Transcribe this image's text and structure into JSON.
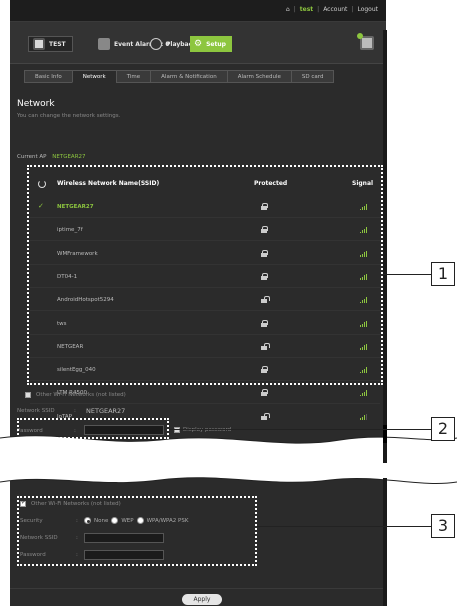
{
  "topbar": {
    "home_icon": "home-icon",
    "user": "test",
    "account": "Account",
    "logout": "Logout",
    "sep": "|"
  },
  "toolbar": {
    "test_label": "TEST",
    "event_alarms_label": "Event Alarms : 0",
    "playback_label": "Playback",
    "setup_label": "Setup"
  },
  "tabs": [
    {
      "label": "Basic Info"
    },
    {
      "label": "Network"
    },
    {
      "label": "Time"
    },
    {
      "label": "Alarm & Notification"
    },
    {
      "label": "Alarm Schedule"
    },
    {
      "label": "SD card"
    }
  ],
  "section": {
    "title": "Network",
    "subtitle": "You can change the network settings."
  },
  "current_ap": {
    "label": "Current AP",
    "value": "NETGEAR27"
  },
  "table": {
    "col_ssid": "Wireless Network Name(SSID)",
    "col_protected": "Protected",
    "col_signal": "Signal",
    "rows": [
      {
        "name": "NETGEAR27",
        "selected": true,
        "lock": "closed",
        "signal": 4
      },
      {
        "name": "iptime_7f",
        "lock": "closed",
        "signal": 4
      },
      {
        "name": "WMFramework",
        "lock": "closed",
        "signal": 4
      },
      {
        "name": "DT04-1",
        "lock": "closed",
        "signal": 4
      },
      {
        "name": "AndroidHotspot5294",
        "lock": "open",
        "signal": 4
      },
      {
        "name": "tws",
        "lock": "closed",
        "signal": 4
      },
      {
        "name": "NETGEAR",
        "lock": "open",
        "signal": 4
      },
      {
        "name": "silentEgg_040",
        "lock": "closed",
        "signal": 4
      },
      {
        "name": "LTM R4500",
        "lock": "closed",
        "signal": 4
      },
      {
        "name": "IoTAP",
        "lock": "open",
        "signal": 3
      }
    ]
  },
  "other_networks": {
    "label": "Other Wi-Fi Networks (not listed)",
    "network_ssid_label": "Network SSID",
    "network_ssid_value": "NETGEAR27",
    "password_label": "Password",
    "display_password_label": "Display password",
    "colon": ":"
  },
  "other_networks_expanded": {
    "label": "Other Wi-Fi Networks (not listed)",
    "security_label": "Security",
    "security_options": [
      "None",
      "WEP",
      "WPA/WPA2 PSK"
    ],
    "security_selected": "None",
    "network_ssid_label": "Network SSID",
    "password_label": "Password",
    "colon": ":"
  },
  "apply_label": "Apply",
  "callouts": [
    "1",
    "2",
    "3"
  ],
  "colors": {
    "accent": "#8dc63f",
    "panel_bg": "#2b2b2b"
  }
}
